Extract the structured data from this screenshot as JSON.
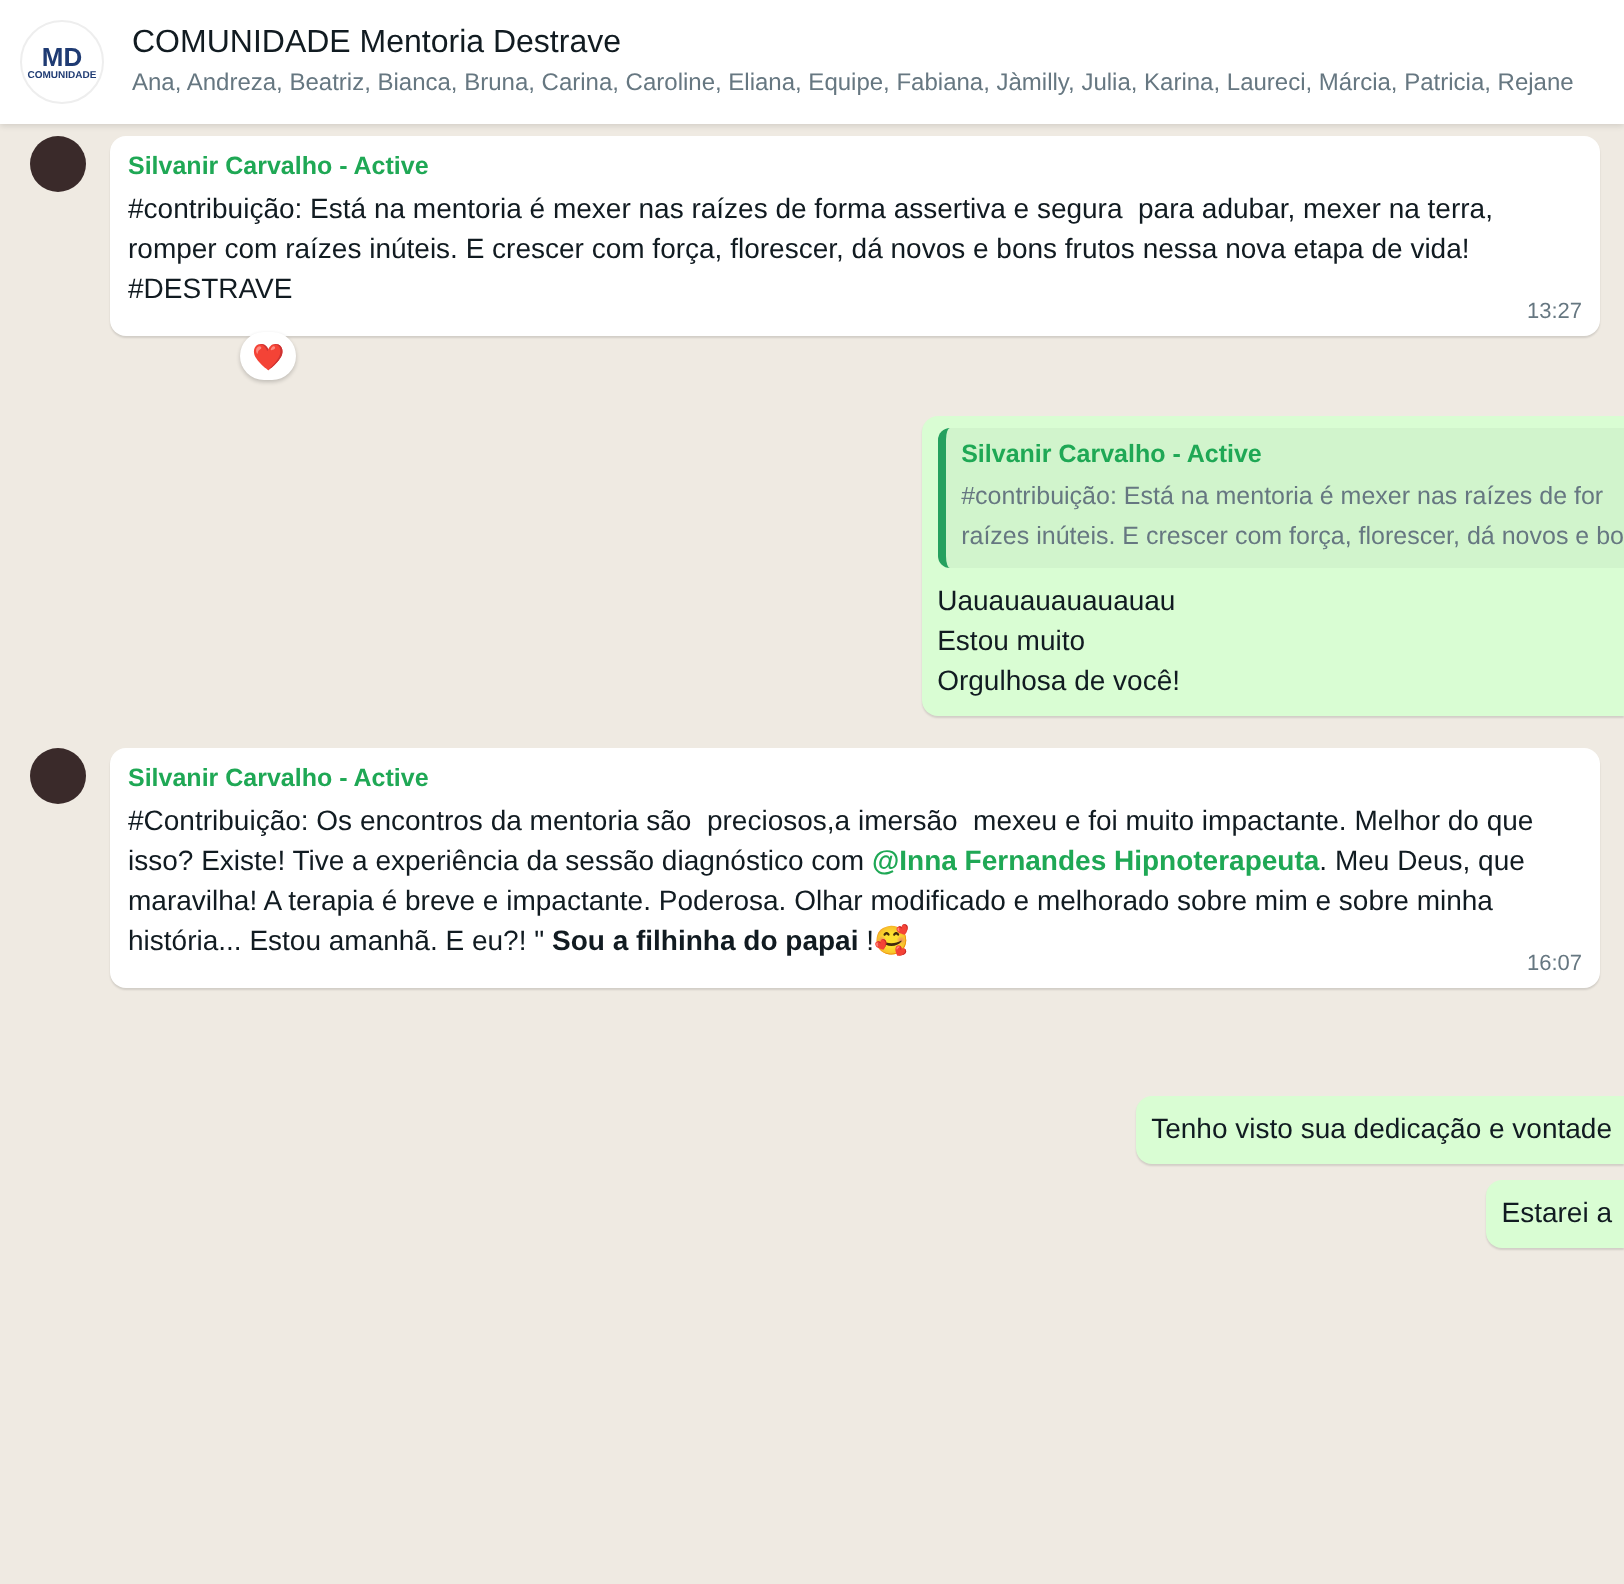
{
  "header": {
    "logo_text": "MD",
    "logo_caption": "COMUNIDADE",
    "title": "COMUNIDADE Mentoria Destrave",
    "members": "Ana, Andreza, Beatriz, Bianca, Bruna, Carina, Caroline, Eliana, Equipe, Fabiana, Jàmilly, Julia, Karina, Laureci, Márcia, Patricia, Rejane"
  },
  "messages": [
    {
      "kind": "incoming",
      "sender": "Silvanir Carvalho - Active",
      "parts": [
        {
          "kind": "text",
          "text": "#contribuição: Está na mentoria é mexer nas raízes de forma assertiva e segura  para adubar, mexer na terra, romper com raízes inúteis. E crescer com força, florescer, dá novos e bons frutos nessa nova etapa de vida!\n#DESTRAVE"
        }
      ],
      "time": "13:27",
      "reaction": "❤️"
    },
    {
      "kind": "outgoing",
      "quote": {
        "sender": "Silvanir Carvalho - Active",
        "lines": [
          "#contribuição: Está na mentoria é mexer nas raízes de for",
          "raízes inúteis. E crescer com força, florescer, dá novos e bo"
        ]
      },
      "lines": [
        "Uauauauauauauau",
        "Estou muito",
        "Orgulhosa de você!"
      ]
    },
    {
      "kind": "incoming",
      "sender": "Silvanir Carvalho - Active",
      "parts": [
        {
          "kind": "text",
          "text": "#Contribuição: Os encontros da mentoria são  preciosos,a imersão  mexeu e foi muito impactante. Melhor do que isso? Existe! Tive a experiência da sessão diagnóstico com "
        },
        {
          "kind": "mention",
          "text": "@Inna Fernandes Hipnoterapeuta"
        },
        {
          "kind": "text",
          "text": ". Meu Deus, que maravilha! A terapia é breve e impactante. Poderosa. Olhar modificado e melhorado sobre mim e sobre minha história... Estou amanhã. E eu?! \" **Sou a filhinha do papai** !🥰"
        }
      ],
      "time": "16:07"
    },
    {
      "kind": "outgoing",
      "lines": [
        "Tenho visto sua dedicação e vontade"
      ]
    },
    {
      "kind": "outgoing",
      "lines": [
        "Estarei a"
      ]
    }
  ]
}
